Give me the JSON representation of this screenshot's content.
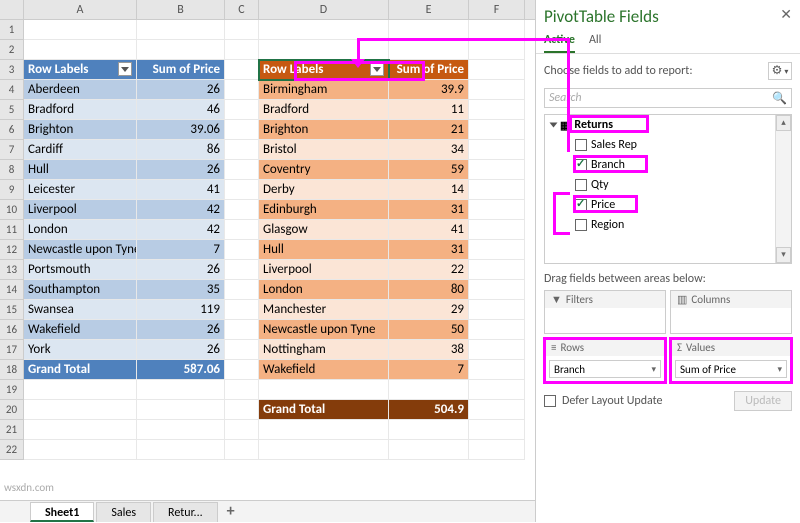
{
  "columns": [
    "A",
    "B",
    "C",
    "D",
    "E",
    "F"
  ],
  "pivot1": {
    "headers": [
      "Row Labels",
      "Sum of Price"
    ],
    "rows": [
      [
        "Aberdeen",
        "26"
      ],
      [
        "Bradford",
        "46"
      ],
      [
        "Brighton",
        "39.06"
      ],
      [
        "Cardiff",
        "86"
      ],
      [
        "Hull",
        "26"
      ],
      [
        "Leicester",
        "41"
      ],
      [
        "Liverpool",
        "42"
      ],
      [
        "London",
        "42"
      ],
      [
        "Newcastle upon Tyne",
        "7"
      ],
      [
        "Portsmouth",
        "26"
      ],
      [
        "Southampton",
        "35"
      ],
      [
        "Swansea",
        "119"
      ],
      [
        "Wakefield",
        "26"
      ],
      [
        "York",
        "26"
      ]
    ],
    "total": [
      "Grand Total",
      "587.06"
    ]
  },
  "pivot2": {
    "headers": [
      "Row Labels",
      "Sum of Price"
    ],
    "rows": [
      [
        "Birmingham",
        "39.9"
      ],
      [
        "Bradford",
        "11"
      ],
      [
        "Brighton",
        "21"
      ],
      [
        "Bristol",
        "34"
      ],
      [
        "Coventry",
        "59"
      ],
      [
        "Derby",
        "14"
      ],
      [
        "Edinburgh",
        "31"
      ],
      [
        "Glasgow",
        "41"
      ],
      [
        "Hull",
        "31"
      ],
      [
        "Liverpool",
        "22"
      ],
      [
        "London",
        "80"
      ],
      [
        "Manchester",
        "29"
      ],
      [
        "Newcastle upon Tyne",
        "50"
      ],
      [
        "Nottingham",
        "38"
      ],
      [
        "Wakefield",
        "7"
      ]
    ],
    "total": [
      "Grand Total",
      "504.9"
    ]
  },
  "sheets": [
    "Sheet1",
    "Sales",
    "Retur..."
  ],
  "panel": {
    "title": "PivotTable Fields",
    "tabs": [
      "Active",
      "All"
    ],
    "hint": "Choose fields to add to report:",
    "search_placeholder": "Search",
    "table": "Returns",
    "fields": [
      {
        "name": "Sales Rep",
        "checked": false
      },
      {
        "name": "Branch",
        "checked": true
      },
      {
        "name": "Qty",
        "checked": false
      },
      {
        "name": "Price",
        "checked": true
      },
      {
        "name": "Region",
        "checked": false
      }
    ],
    "drag_hint": "Drag fields between areas below:",
    "filters": "Filters",
    "columns": "Columns",
    "rows_label": "Rows",
    "values_label": "Values",
    "rows_item": "Branch",
    "values_item": "Sum of Price",
    "defer": "Defer Layout Update",
    "update": "Update"
  },
  "watermark": "wsxdn.com"
}
